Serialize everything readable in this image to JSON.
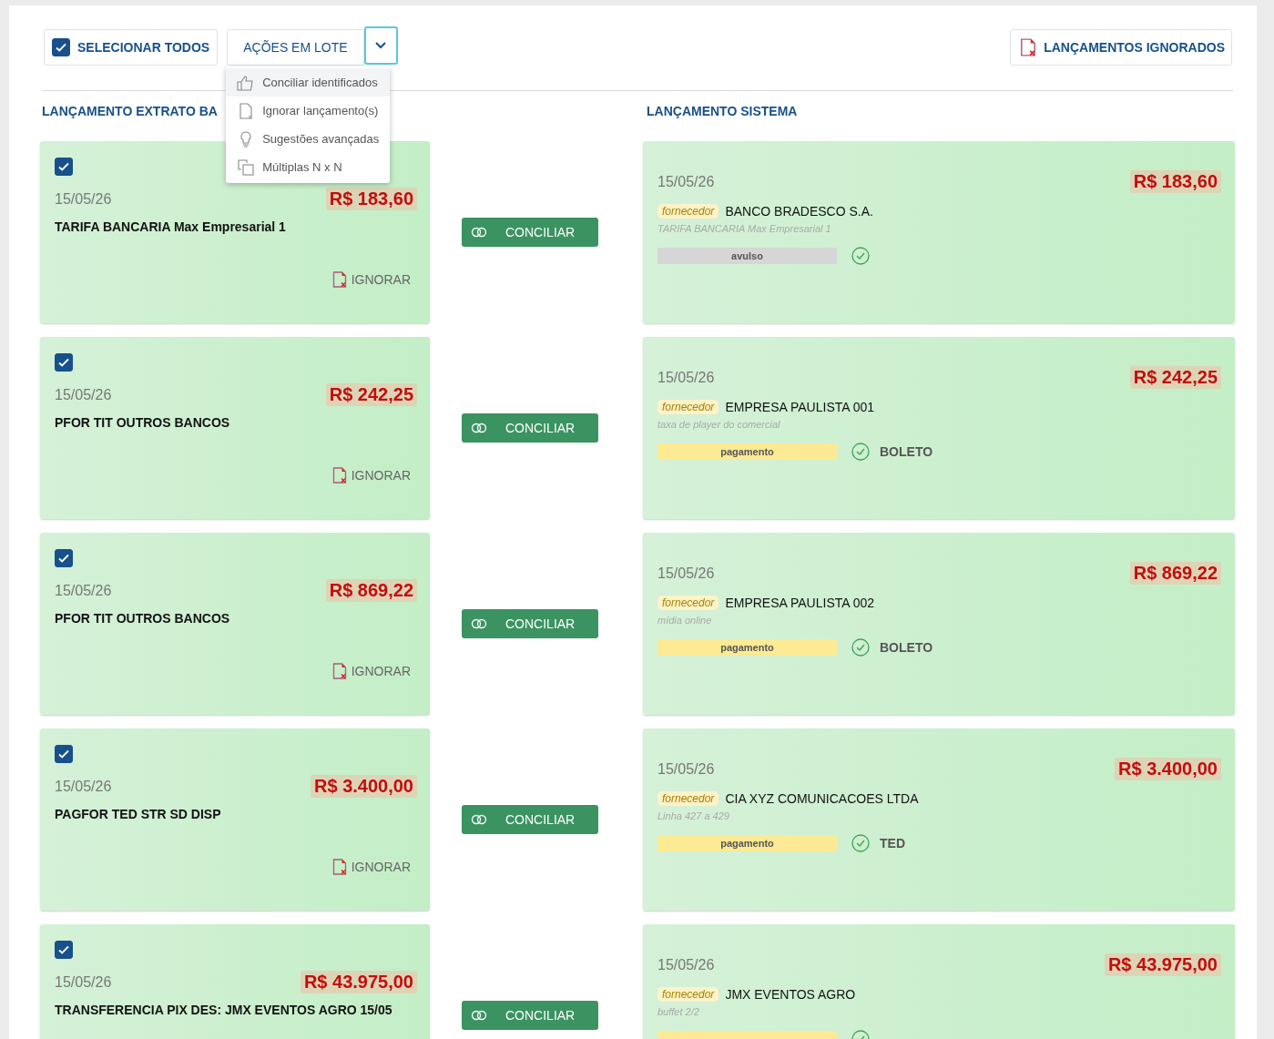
{
  "toolbar": {
    "select_all": {
      "label": "SELECIONAR TODOS",
      "checked": true
    },
    "batch_actions": {
      "label": "AÇÕES EM LOTE",
      "expanded": true,
      "menu": [
        {
          "label": "Conciliar identificados",
          "selected": true
        },
        {
          "label": "Ignorar lançamento(s)",
          "selected": false
        },
        {
          "label": "Sugestões avançadas",
          "selected": false
        },
        {
          "label": "Múltiplas N x N",
          "selected": false
        }
      ]
    },
    "ignored_button": {
      "label": "LANÇAMENTOS IGNORADOS"
    }
  },
  "headings": {
    "left": "LANÇAMENTO EXTRATO BA",
    "right": "LANÇAMENTO SISTEMA"
  },
  "rows": [
    {
      "statement": {
        "checked": true,
        "date": "15/05/26",
        "amount": "R$ 183,60",
        "description": "TARIFA BANCARIA Max Empresarial 1",
        "ignore": "IGNORAR"
      },
      "action": "CONCILIAR",
      "system": {
        "date": "15/05/26",
        "amount": "R$ 183,60",
        "role": "fornecedor",
        "party": "BANCO BRADESCO S.A.",
        "note": "TARIFA BANCARIA Max Empresarial 1",
        "tag": {
          "kind": "avulso",
          "label": "avulso"
        },
        "matched": true
      }
    },
    {
      "statement": {
        "checked": true,
        "date": "15/05/26",
        "amount": "R$ 242,25",
        "description": "PFOR TIT OUTROS BANCOS",
        "ignore": "IGNORAR"
      },
      "action": "CONCILIAR",
      "system": {
        "date": "15/05/26",
        "amount": "R$ 242,25",
        "role": "fornecedor",
        "party": "EMPRESA PAULISTA 001",
        "note": "taxa de player do comercial",
        "tag": {
          "kind": "pagamento",
          "label": "pagamento"
        },
        "matched": true,
        "method": "BOLETO"
      }
    },
    {
      "statement": {
        "checked": true,
        "date": "15/05/26",
        "amount": "R$ 869,22",
        "description": "PFOR TIT OUTROS BANCOS",
        "ignore": "IGNORAR"
      },
      "action": "CONCILIAR",
      "system": {
        "date": "15/05/26",
        "amount": "R$ 869,22",
        "role": "fornecedor",
        "party": "EMPRESA PAULISTA 002",
        "note": "mídia online",
        "tag": {
          "kind": "pagamento",
          "label": "pagamento"
        },
        "matched": true,
        "method": "BOLETO"
      }
    },
    {
      "statement": {
        "checked": true,
        "date": "15/05/26",
        "amount": "R$ 3.400,00",
        "description": "PAGFOR TED STR SD DISP",
        "ignore": "IGNORAR"
      },
      "action": "CONCILIAR",
      "system": {
        "date": "15/05/26",
        "amount": "R$ 3.400,00",
        "role": "fornecedor",
        "party": "CIA XYZ COMUNICACOES LTDA",
        "note": "Linha 427 a 429",
        "tag": {
          "kind": "pagamento",
          "label": "pagamento"
        },
        "matched": true,
        "method": "TED"
      }
    },
    {
      "statement": {
        "checked": true,
        "date": "15/05/26",
        "amount": "R$ 43.975,00",
        "description": "TRANSFERENCIA PIX DES: JMX EVENTOS AGRO 15/05"
      },
      "action": "CONCILIAR",
      "system": {
        "date": "15/05/26",
        "amount": "R$ 43.975,00",
        "role": "fornecedor",
        "party": "JMX EVENTOS AGRO",
        "note": "buffet 2/2",
        "tag": {
          "kind": "pagamento"
        },
        "matched": true
      }
    }
  ]
}
